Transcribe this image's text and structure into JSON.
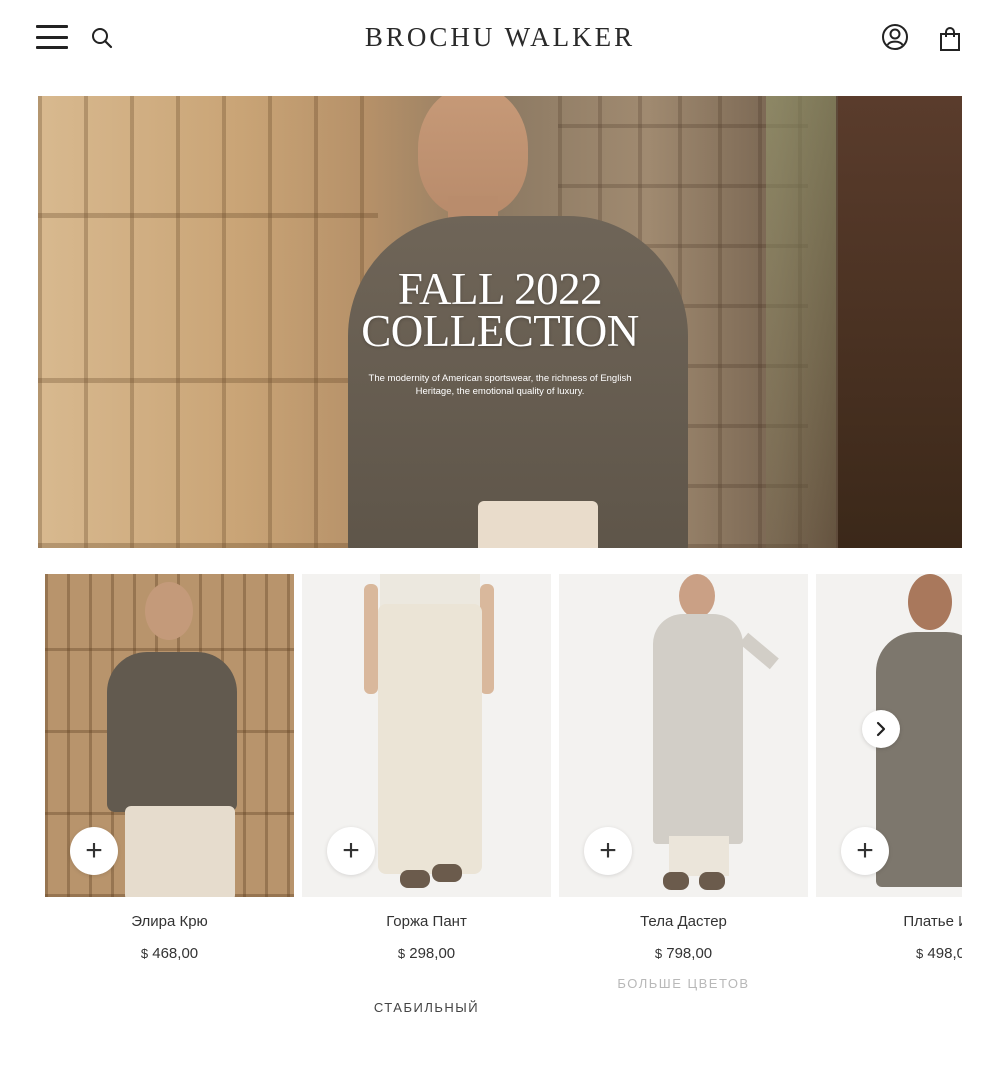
{
  "header": {
    "logo": "BROCHU WALKER",
    "icons": [
      "menu-icon",
      "search-icon",
      "account-icon",
      "shopping-bag-icon"
    ]
  },
  "hero": {
    "title_line1": "FALL 2022",
    "title_line2": "COLLECTION",
    "subtitle": "The modernity of American sportswear, the richness of English Heritage, the emotional quality of luxury."
  },
  "products": [
    {
      "name": "Элира Крю",
      "currency": "$",
      "price": "468,00"
    },
    {
      "name": "Горжа Пант",
      "currency": "$",
      "price": "298,00",
      "badge": "СТАБИЛЬНЫЙ"
    },
    {
      "name": "Тела Дастер",
      "currency": "$",
      "price": "798,00",
      "more_colors": "БОЛЬШЕ ЦВЕТОВ"
    },
    {
      "name": "Платье Ид",
      "currency": "$",
      "price": "498,0"
    }
  ],
  "add_button_label": "+",
  "colors": {
    "text": "#222222",
    "muted": "#b8b8b8"
  }
}
